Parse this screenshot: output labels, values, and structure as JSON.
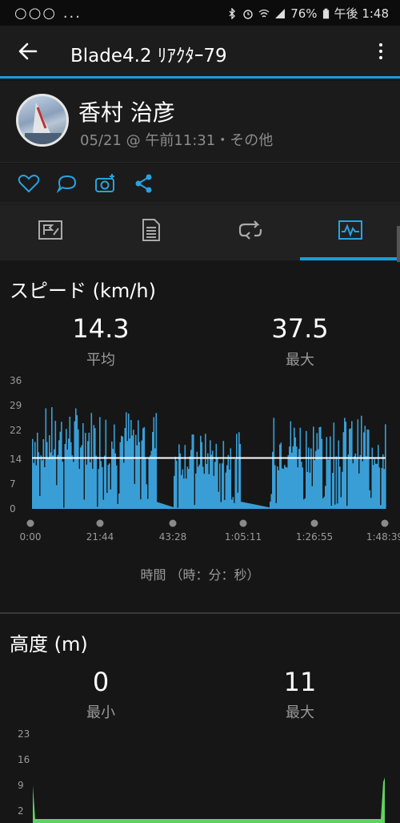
{
  "status_bar": {
    "left_icons": "○○○ ...",
    "battery": "76%",
    "time": "午後 1:48"
  },
  "app_bar": {
    "title": "Blade4.2 ﾘｱｸﾀｰ79"
  },
  "profile": {
    "name": "香村 治彦",
    "meta": "05/21 @ 午前11:31・その他"
  },
  "actions": [
    "heart-icon",
    "comment-icon",
    "camera-add-icon",
    "share-icon"
  ],
  "tabs": [
    {
      "name": "overview",
      "icon": "map-flag-icon",
      "active": false
    },
    {
      "name": "details",
      "icon": "document-icon",
      "active": false
    },
    {
      "name": "laps",
      "icon": "loop-icon",
      "active": false
    },
    {
      "name": "charts",
      "icon": "chart-icon",
      "active": true
    }
  ],
  "speed": {
    "title": "スピード (km/h)",
    "avg_value": "14.3",
    "avg_label": "平均",
    "max_value": "37.5",
    "max_label": "最大",
    "x_axis_label": "時間 （時：分：秒）"
  },
  "elevation": {
    "title": "高度 (m)",
    "min_value": "0",
    "min_label": "最小",
    "max_value": "11",
    "max_label": "最大"
  },
  "chart_data": [
    {
      "type": "area",
      "ylim": [
        0,
        36
      ],
      "y_ticks": [
        "36",
        "29",
        "22",
        "14",
        "7",
        "0"
      ],
      "x_ticks": [
        "0:00",
        "21:44",
        "43:28",
        "1:05:11",
        "1:26:55",
        "1:48:39"
      ],
      "average_line": 14.3,
      "series_color": "#3a9ed6",
      "segments": [
        {
          "from": 0,
          "to": 0.35,
          "level": 24
        },
        {
          "from": 0.35,
          "to": 0.4,
          "level": 2
        },
        {
          "from": 0.4,
          "to": 0.59,
          "level": 18
        },
        {
          "from": 0.59,
          "to": 0.67,
          "level": 2
        },
        {
          "from": 0.67,
          "to": 1.0,
          "level": 22
        }
      ]
    },
    {
      "type": "area",
      "ylim": [
        2,
        23
      ],
      "y_ticks": [
        "23",
        "16",
        "9",
        "2"
      ],
      "series_color": "#5fd35f",
      "values_note": "near 2 m throughout, spikes to ~9 m at start and ~11 m at end"
    }
  ]
}
